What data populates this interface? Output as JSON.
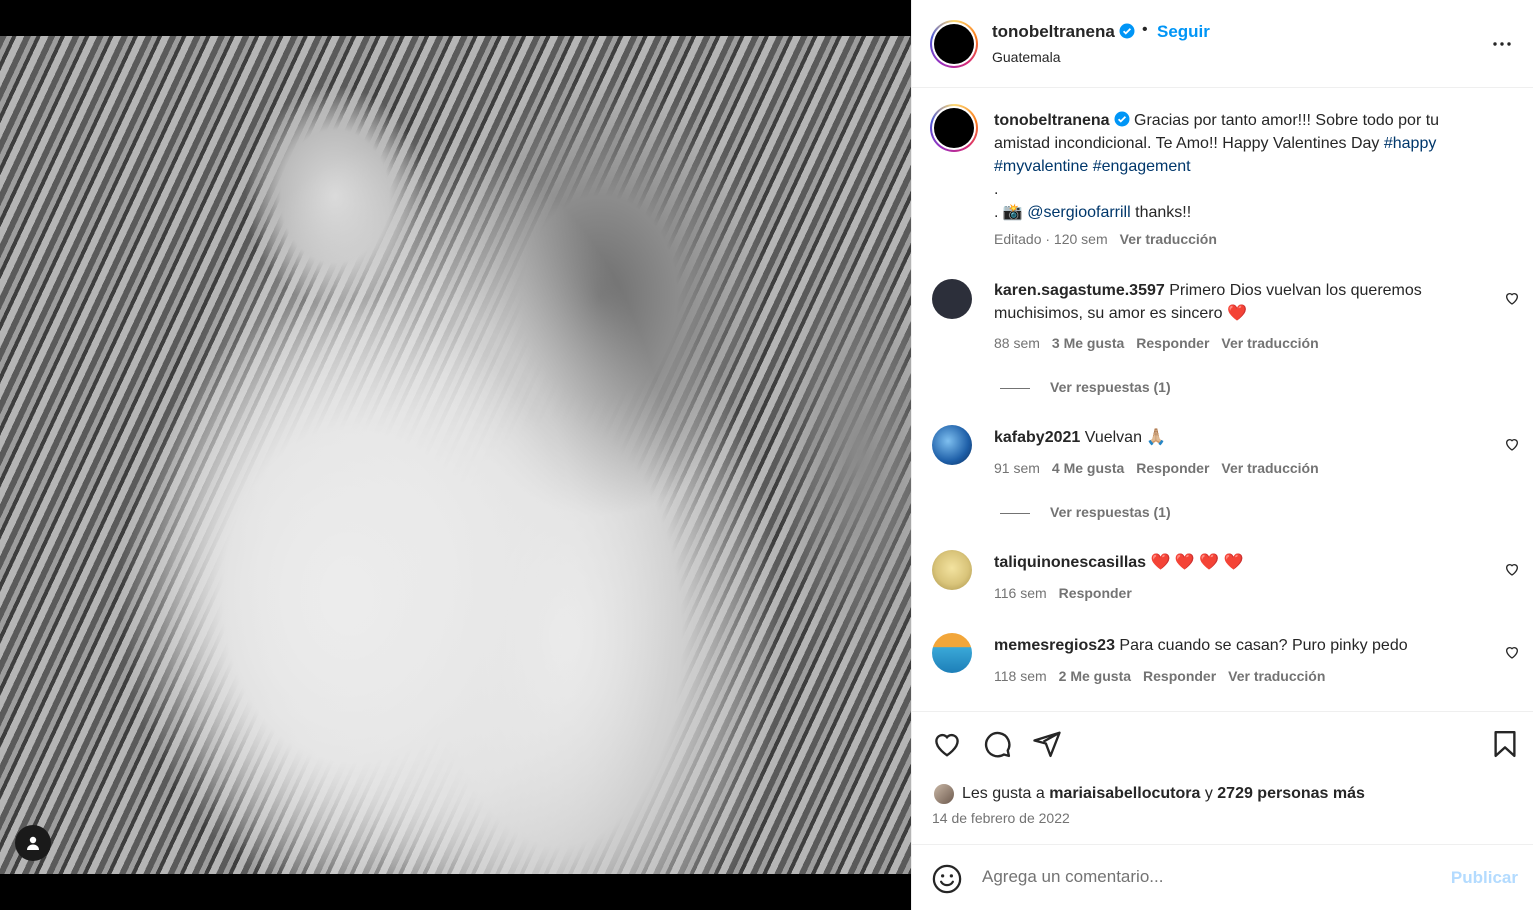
{
  "post": {
    "author": "tonobeltranena",
    "follow_label": "Seguir",
    "bullet": "•",
    "location": "Guatemala"
  },
  "caption": {
    "author": "tonobeltranena",
    "line1": "Gracias por tanto amor!!! Sobre todo por tu",
    "line2a": "amistad incondicional. Te Amo!! Happy Valentines Day ",
    "tag_happy": "#happy",
    "tag_myvalentine": "#myvalentine",
    "tag_engagement": "#engagement",
    "dot1": ".",
    "dot2": ".",
    "camera": "📸",
    "mention": "@sergioofarrill",
    "thanks": "thanks!!",
    "meta_time": "Editado · 120 sem",
    "meta_translate": "Ver traducción"
  },
  "comments": [
    {
      "user": "karen.sagastume.3597",
      "text1": "Primero Dios vuelvan los queremos",
      "text2": "muchisimos, su amor es sincero ❤️",
      "time": "88 sem",
      "likes": "3 Me gusta",
      "reply": "Responder",
      "translate": "Ver traducción",
      "replies": "Ver respuestas (1)",
      "avatar_color": "#2c2f3a"
    },
    {
      "user": "kafaby2021",
      "text1": "Vuelvan 🙏🏼",
      "time": "91 sem",
      "likes": "4 Me gusta",
      "reply": "Responder",
      "translate": "Ver traducción",
      "replies": "Ver respuestas (1)",
      "avatar_color": "#1e5fa8"
    },
    {
      "user": "taliquinonescasillas",
      "text1": "❤️ ❤️ ❤️ ❤️",
      "time": "116 sem",
      "reply": "Responder",
      "avatar_color": "#d9c47a"
    },
    {
      "user": "memesregios23",
      "text1": "Para cuando se casan? Puro pinky pedo",
      "time": "118 sem",
      "likes": "2 Me gusta",
      "reply": "Responder",
      "translate": "Ver traducción",
      "avatar_color": "#3aa8d8"
    }
  ],
  "likes": {
    "prefix": "Les gusta a",
    "user": "mariaisabellocutora",
    "conj": "y",
    "others": "2729 personas más"
  },
  "date": "14 de febrero de 2022",
  "composer": {
    "placeholder": "Agrega un comentario...",
    "publish": "Publicar"
  },
  "icons": [
    "user-tag-icon",
    "verified-icon",
    "more-icon",
    "heart-icon",
    "comment-icon",
    "share-icon",
    "bookmark-icon",
    "emoji-icon"
  ],
  "colors": {
    "accent": "#0095f6",
    "link": "#00376b",
    "secondary": "#737373",
    "publish_disabled": "#b3dbff"
  }
}
